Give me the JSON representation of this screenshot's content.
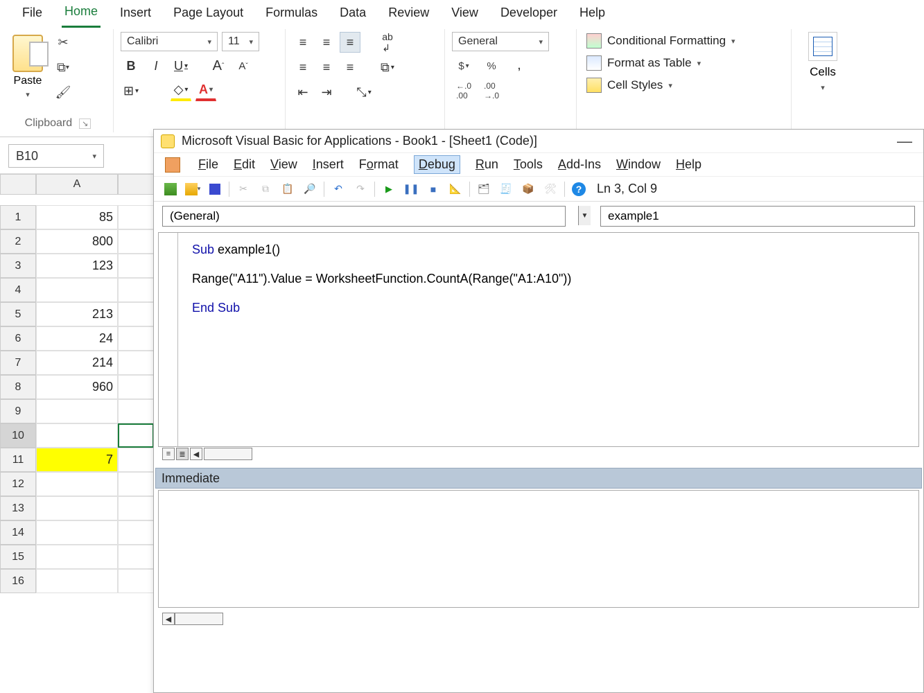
{
  "excel": {
    "tabs": [
      "File",
      "Home",
      "Insert",
      "Page Layout",
      "Formulas",
      "Data",
      "Review",
      "View",
      "Developer",
      "Help"
    ],
    "active_tab": "Home",
    "clipboard": {
      "paste": "Paste",
      "group": "Clipboard"
    },
    "font": {
      "name": "Calibri",
      "size": "11",
      "bold": "B",
      "italic": "I",
      "underline": "U",
      "growA": "A",
      "shrinkA": "A"
    },
    "number": {
      "format": "General",
      "currency": "$",
      "percent": "%",
      "comma": ",",
      "inc": ".00→.0",
      "dec": ".0→.00"
    },
    "styles": {
      "cond": "Conditional Formatting",
      "table": "Format as Table",
      "cell": "Cell Styles"
    },
    "cells": {
      "label": "Cells"
    },
    "namebox": "B10",
    "columns": [
      "A",
      ""
    ],
    "rows": [
      {
        "n": "1",
        "A": "85"
      },
      {
        "n": "2",
        "A": "800"
      },
      {
        "n": "3",
        "A": "123"
      },
      {
        "n": "4",
        "A": ""
      },
      {
        "n": "5",
        "A": "213"
      },
      {
        "n": "6",
        "A": "24"
      },
      {
        "n": "7",
        "A": "214"
      },
      {
        "n": "8",
        "A": "960"
      },
      {
        "n": "9",
        "A": ""
      },
      {
        "n": "10",
        "A": "",
        "selectedB": true
      },
      {
        "n": "11",
        "A": "7",
        "hilite": true
      },
      {
        "n": "12",
        "A": ""
      },
      {
        "n": "13",
        "A": ""
      },
      {
        "n": "14",
        "A": ""
      },
      {
        "n": "15",
        "A": ""
      },
      {
        "n": "16",
        "A": ""
      }
    ]
  },
  "vbe": {
    "title": "Microsoft Visual Basic for Applications - Book1 - [Sheet1 (Code)]",
    "menu": [
      "File",
      "Edit",
      "View",
      "Insert",
      "Format",
      "Debug",
      "Run",
      "Tools",
      "Add-Ins",
      "Window",
      "Help"
    ],
    "active_menu": "Debug",
    "position": "Ln 3, Col 9",
    "combo_object": "(General)",
    "combo_proc": "example1",
    "code": {
      "l1a": "Sub",
      "l1b": " example1()",
      "l2": "Range(\"A11\").Value = WorksheetFunction.CountA(Range(\"A1:A10\"))",
      "l3a": "End",
      "l3b": " ",
      "l3c": "Sub"
    },
    "immediate": "Immediate"
  }
}
